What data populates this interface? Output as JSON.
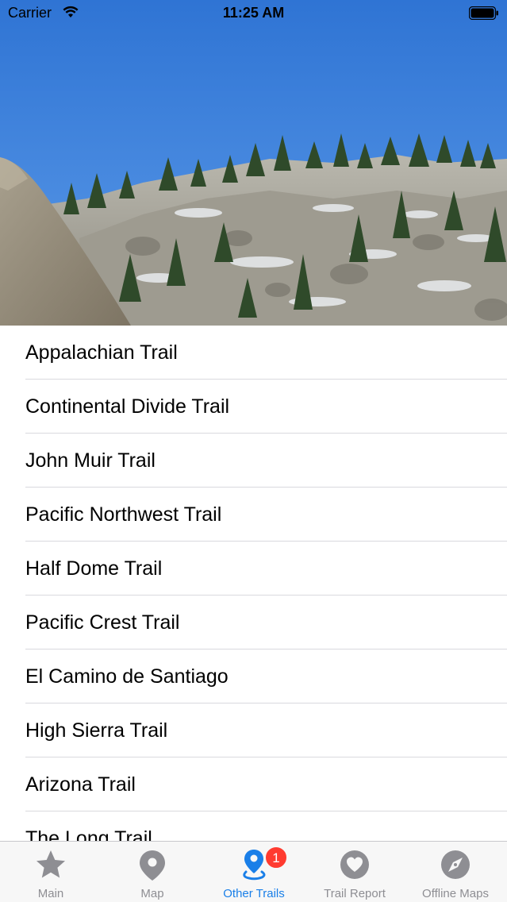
{
  "status_bar": {
    "carrier": "Carrier",
    "time": "11:25 AM"
  },
  "trails": [
    {
      "name": "Appalachian Trail"
    },
    {
      "name": "Continental Divide Trail"
    },
    {
      "name": "John Muir Trail"
    },
    {
      "name": "Pacific Northwest Trail"
    },
    {
      "name": "Half Dome Trail"
    },
    {
      "name": "Pacific Crest Trail"
    },
    {
      "name": "El Camino de Santiago"
    },
    {
      "name": "High Sierra Trail"
    },
    {
      "name": "Arizona Trail"
    },
    {
      "name": "The Long Trail"
    }
  ],
  "tab_bar": {
    "selected": "other-trails",
    "tabs": [
      {
        "label": "Main",
        "icon": "star-icon"
      },
      {
        "label": "Map",
        "icon": "map-pin-icon"
      },
      {
        "label": "Other Trails",
        "icon": "route-pin-icon",
        "badge": "1"
      },
      {
        "label": "Trail Report",
        "icon": "heart-icon"
      },
      {
        "label": "Offline Maps",
        "icon": "compass-icon"
      }
    ]
  },
  "colors": {
    "accent": "#1a7fe8",
    "inactive": "#8e8e93",
    "badge": "#ff3b30",
    "tab_bar_bg": "#f7f7f7",
    "sky": "#4a8ee0"
  }
}
